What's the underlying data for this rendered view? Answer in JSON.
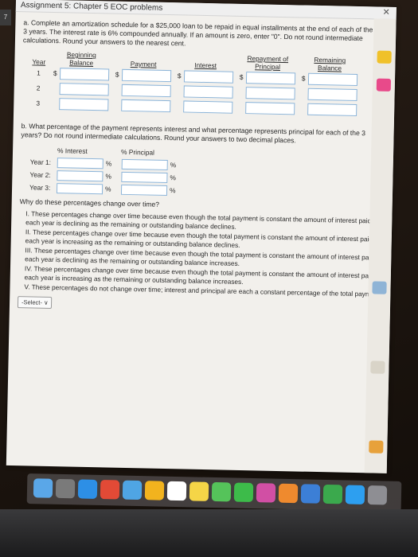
{
  "window": {
    "title": "Assignment 5: Chapter 5 EOC problems",
    "close_label": "✕",
    "left_tab_label": "7"
  },
  "question_a": {
    "prompt": "a. Complete an amortization schedule for a $25,000 loan to be repaid in equal installments at the end of each of the next 3 years. The interest rate is 6% compounded annually. If an amount is zero, enter \"0\". Do not round intermediate calculations. Round your answers to the nearest cent.",
    "columns": [
      "Year",
      "Beginning Balance",
      "Payment",
      "Interest",
      "Repayment of Principal",
      "Remaining Balance"
    ],
    "currency": "$",
    "years": [
      "1",
      "2",
      "3"
    ]
  },
  "question_b": {
    "prompt": "b. What percentage of the payment represents interest and what percentage represents principal for each of the 3 years? Do not round intermediate calculations. Round your answers to two decimal places.",
    "header_interest": "% Interest",
    "header_principal": "% Principal",
    "rows": [
      "Year 1:",
      "Year 2:",
      "Year 3:"
    ],
    "pct": "%",
    "why_prompt": "Why do these percentages change over time?",
    "options": [
      "I. These percentages change over time because even though the total payment is constant the amount of interest paid each year is declining as the remaining or outstanding balance declines.",
      "II. These percentages change over time because even though the total payment is constant the amount of interest paid each year is increasing as the remaining or outstanding balance declines.",
      "III. These percentages change over time because even though the total payment is constant the amount of interest paid each year is declining as the remaining or outstanding balance increases.",
      "IV. These percentages change over time because even though the total payment is constant the amount of interest paid each year is increasing as the remaining or outstanding balance increases.",
      "V. These percentages do not change over time; interest and principal are each a constant percentage of the total payment."
    ],
    "select_label": "-Select- ∨"
  },
  "colors": {
    "input_border": "#8cb4d8",
    "screen_bg": "#f2f0ec"
  },
  "dock_icons": [
    "finder-icon",
    "launchpad-icon",
    "safari-icon",
    "chrome-icon",
    "mail-icon",
    "photos-icon",
    "calendar-icon",
    "notes-icon",
    "messages-icon",
    "facetime-icon",
    "itunes-icon",
    "books-icon",
    "keynote-icon",
    "numbers-icon",
    "appstore-icon",
    "settings-icon"
  ]
}
